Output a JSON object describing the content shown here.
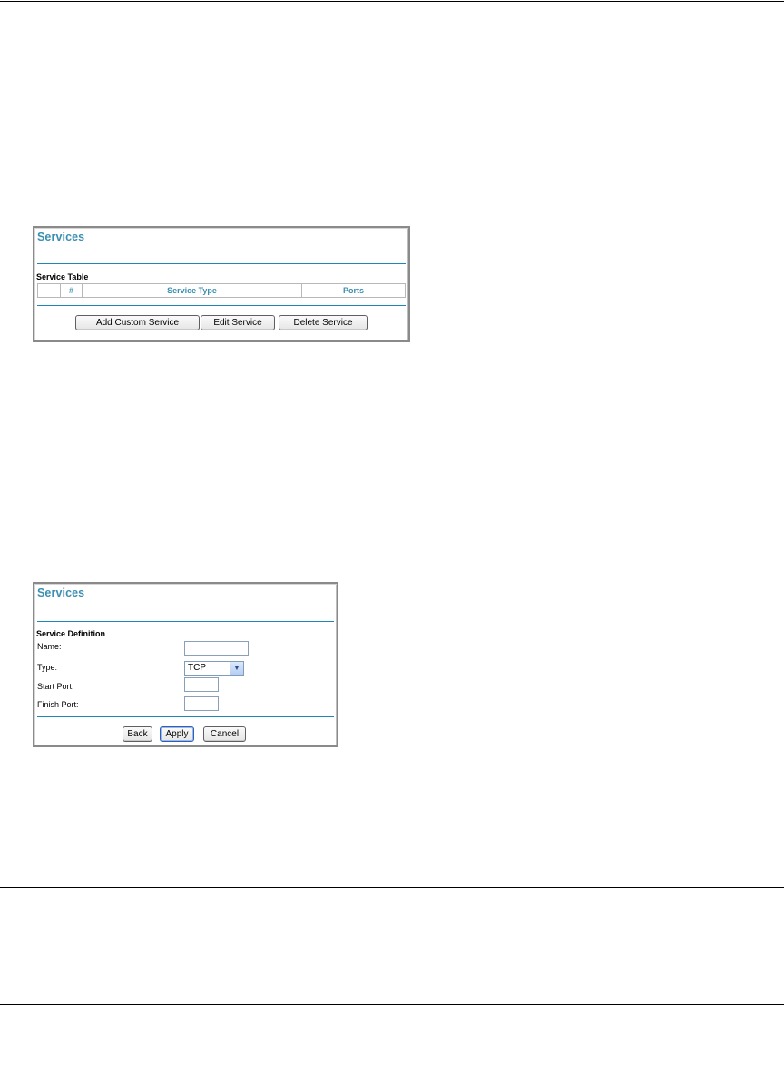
{
  "services_list": {
    "title": "Services",
    "section_label": "Service Table",
    "table_headers": [
      "",
      "#",
      "Service Type",
      "Ports"
    ],
    "buttons": {
      "add": "Add Custom Service",
      "edit": "Edit Service",
      "delete": "Delete Service"
    }
  },
  "service_definition": {
    "title": "Services",
    "section_label": "Service Definition",
    "fields": {
      "name_label": "Name:",
      "name_value": "",
      "type_label": "Type:",
      "type_value": "TCP",
      "start_port_label": "Start Port:",
      "start_port_value": "",
      "finish_port_label": "Finish Port:",
      "finish_port_value": ""
    },
    "buttons": {
      "back": "Back",
      "apply": "Apply",
      "cancel": "Cancel"
    }
  },
  "icons": {
    "select_arrow": "chevron-down-icon"
  }
}
